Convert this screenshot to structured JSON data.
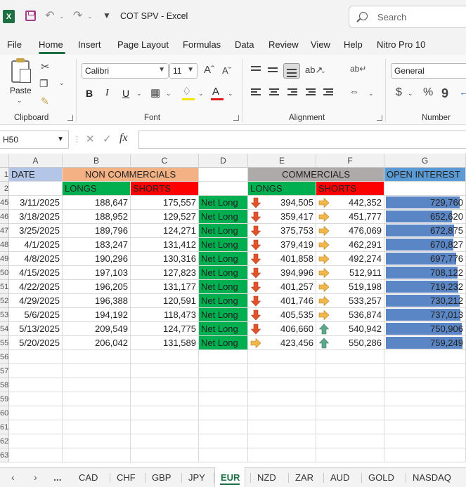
{
  "window": {
    "title": "COT SPV  -  Excel",
    "logo_letter": "X",
    "search_placeholder": "Search"
  },
  "menu": [
    "File",
    "Home",
    "Insert",
    "Page Layout",
    "Formulas",
    "Data",
    "Review",
    "View",
    "Help",
    "Nitro Pro 10"
  ],
  "ribbon": {
    "paste_label": "Paste",
    "font_name": "Calibri",
    "font_size": "11",
    "number_format": "General",
    "groups": [
      "Clipboard",
      "Font",
      "Alignment",
      "Number"
    ]
  },
  "formula_bar": {
    "name_box": "H50",
    "fx_label": "fx",
    "formula": ""
  },
  "columns": [
    "A",
    "B",
    "C",
    "D",
    "E",
    "F",
    "G"
  ],
  "row_numbers": [
    "1",
    "2",
    "45",
    "46",
    "47",
    "48",
    "49",
    "50",
    "51",
    "52",
    "53",
    "54",
    "55",
    "56",
    "57",
    "58",
    "59",
    "60",
    "61",
    "62",
    "63"
  ],
  "headers": {
    "date": "DATE",
    "non_commercials": "NON COMMERCIALS",
    "commercials": "COMMERCIALS",
    "open_interest": "OPEN INTEREST",
    "longs": "LONGS",
    "shorts": "SHORTS",
    "comm_longs": "LONGS",
    "comm_shorts": "SHORTS"
  },
  "colors": {
    "date_header": "#b4c6e7",
    "non_comm_header": "#f4b183",
    "comm_header": "#aeaaaa",
    "oi_header": "#5b9bd5",
    "longs": "#00b050",
    "shorts": "#ff0000",
    "net_long": "#00b050",
    "oi_bar": "#5b86c5",
    "accent": "#1d6f42"
  },
  "rows": [
    {
      "date": "3/11/2025",
      "nc_longs": "188,647",
      "nc_shorts": "175,557",
      "status": "Net Long",
      "c_longs_icon": "down-arrow-icon",
      "c_longs": "394,505",
      "c_shorts_icon": "right-arrow-icon",
      "c_shorts": "442,352",
      "oi": "729,760",
      "oi_value": 729760
    },
    {
      "date": "3/18/2025",
      "nc_longs": "188,952",
      "nc_shorts": "129,527",
      "status": "Net Long",
      "c_longs_icon": "down-arrow-icon",
      "c_longs": "359,417",
      "c_shorts_icon": "right-arrow-icon",
      "c_shorts": "451,777",
      "oi": "652,620",
      "oi_value": 652620
    },
    {
      "date": "3/25/2025",
      "nc_longs": "189,796",
      "nc_shorts": "124,271",
      "status": "Net Long",
      "c_longs_icon": "down-arrow-icon",
      "c_longs": "375,753",
      "c_shorts_icon": "right-arrow-icon",
      "c_shorts": "476,069",
      "oi": "672,875",
      "oi_value": 672875
    },
    {
      "date": "4/1/2025",
      "nc_longs": "183,247",
      "nc_shorts": "131,412",
      "status": "Net Long",
      "c_longs_icon": "down-arrow-icon",
      "c_longs": "379,419",
      "c_shorts_icon": "right-arrow-icon",
      "c_shorts": "462,291",
      "oi": "670,827",
      "oi_value": 670827
    },
    {
      "date": "4/8/2025",
      "nc_longs": "190,296",
      "nc_shorts": "130,316",
      "status": "Net Long",
      "c_longs_icon": "down-arrow-icon",
      "c_longs": "401,858",
      "c_shorts_icon": "right-arrow-icon",
      "c_shorts": "492,274",
      "oi": "697,776",
      "oi_value": 697776
    },
    {
      "date": "4/15/2025",
      "nc_longs": "197,103",
      "nc_shorts": "127,823",
      "status": "Net Long",
      "c_longs_icon": "down-arrow-icon",
      "c_longs": "394,996",
      "c_shorts_icon": "right-arrow-icon",
      "c_shorts": "512,911",
      "oi": "708,122",
      "oi_value": 708122
    },
    {
      "date": "4/22/2025",
      "nc_longs": "196,205",
      "nc_shorts": "131,177",
      "status": "Net Long",
      "c_longs_icon": "down-arrow-icon",
      "c_longs": "401,257",
      "c_shorts_icon": "right-arrow-icon",
      "c_shorts": "519,198",
      "oi": "719,232",
      "oi_value": 719232
    },
    {
      "date": "4/29/2025",
      "nc_longs": "196,388",
      "nc_shorts": "120,591",
      "status": "Net Long",
      "c_longs_icon": "down-arrow-icon",
      "c_longs": "401,746",
      "c_shorts_icon": "right-arrow-icon",
      "c_shorts": "533,257",
      "oi": "730,212",
      "oi_value": 730212
    },
    {
      "date": "5/6/2025",
      "nc_longs": "194,192",
      "nc_shorts": "118,473",
      "status": "Net Long",
      "c_longs_icon": "down-arrow-icon",
      "c_longs": "405,535",
      "c_shorts_icon": "right-arrow-icon",
      "c_shorts": "536,874",
      "oi": "737,013",
      "oi_value": 737013
    },
    {
      "date": "5/13/2025",
      "nc_longs": "209,549",
      "nc_shorts": "124,775",
      "status": "Net Long",
      "c_longs_icon": "down-arrow-icon",
      "c_longs": "406,660",
      "c_shorts_icon": "up-arrow-icon",
      "c_shorts": "540,942",
      "oi": "750,906",
      "oi_value": 750906
    },
    {
      "date": "5/20/2025",
      "nc_longs": "206,042",
      "nc_shorts": "131,589",
      "status": "Net Long",
      "c_longs_icon": "right-arrow-icon",
      "c_longs": "423,456",
      "c_shorts_icon": "up-arrow-icon",
      "c_shorts": "550,286",
      "oi": "759,249",
      "oi_value": 759249
    }
  ],
  "sheet_tabs": [
    "CAD",
    "CHF",
    "GBP",
    "JPY",
    "EUR",
    "NZD",
    "ZAR",
    "AUD",
    "GOLD",
    "NASDAQ"
  ],
  "active_tab": "EUR",
  "tab_more": "..."
}
